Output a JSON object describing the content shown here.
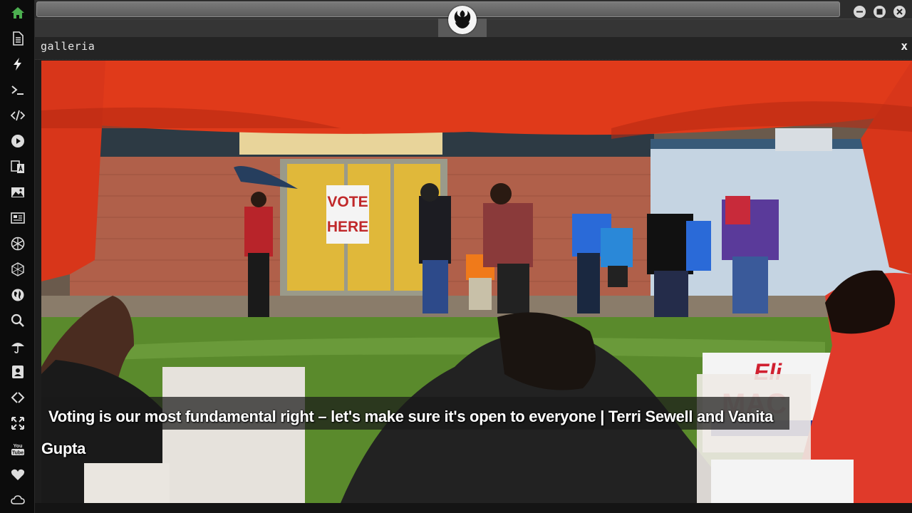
{
  "window": {
    "panel_title": "galleria",
    "close_label": "x"
  },
  "dock": {
    "items": [
      {
        "icon": "home-icon",
        "active": true
      },
      {
        "icon": "document-icon"
      },
      {
        "icon": "lightning-icon"
      },
      {
        "icon": "terminal-icon"
      },
      {
        "icon": "code-icon"
      },
      {
        "icon": "play-icon"
      },
      {
        "icon": "translate-icon"
      },
      {
        "icon": "image-icon"
      },
      {
        "icon": "newspaper-icon"
      },
      {
        "icon": "aperture-icon"
      },
      {
        "icon": "hexagon-icon"
      },
      {
        "icon": "globe-icon"
      },
      {
        "icon": "search-icon"
      },
      {
        "icon": "umbrella-icon"
      },
      {
        "icon": "contact-card-icon"
      },
      {
        "icon": "link-icon"
      },
      {
        "icon": "expand-icon"
      },
      {
        "icon": "youtube-icon"
      },
      {
        "icon": "heart-icon"
      },
      {
        "icon": "cloud-icon"
      }
    ],
    "accent_color": "#4caf50"
  },
  "gallery": {
    "caption": "Voting is our most fundamental right – let's make sure it's open to everyone | Terri Sewell and Vanita Gupta",
    "sign_text": "VOTE HERE",
    "campaign_sign_text": "Eli MAC"
  }
}
